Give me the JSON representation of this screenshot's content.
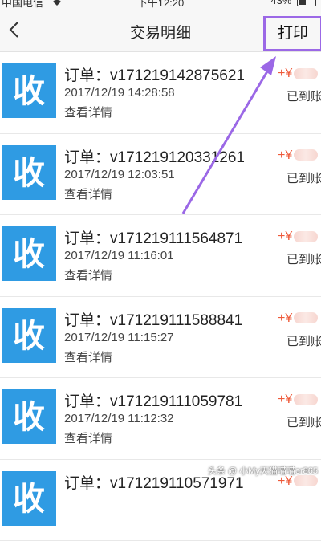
{
  "statusbar": {
    "carrier": "中国电信",
    "time": "下午12:20",
    "battery": "43%",
    "battery_level": 0.43
  },
  "nav": {
    "title": "交易明细",
    "print_label": "打印"
  },
  "colors": {
    "accent": "#2f9be3",
    "amount": "#ee5a3a",
    "highlight": "#9b68e6"
  },
  "transactions": [
    {
      "order": "订单：v171219142875621",
      "date": "2017/12/19 14:28:58",
      "detail": "查看详情",
      "amount": "+¥",
      "status": "已到账"
    },
    {
      "order": "订单：v171219120331261",
      "date": "2017/12/19 12:03:51",
      "detail": "查看详情",
      "amount": "+¥",
      "status": "已到账"
    },
    {
      "order": "订单：v171219111564871",
      "date": "2017/12/19 11:16:01",
      "detail": "查看详情",
      "amount": "+¥",
      "status": "已到账"
    },
    {
      "order": "订单：v171219111588841",
      "date": "2017/12/19 11:15:27",
      "detail": "查看详情",
      "amount": "+¥",
      "status": "已到账"
    },
    {
      "order": "订单：v171219111059781",
      "date": "2017/12/19 11:12:32",
      "detail": "查看详情",
      "amount": "+¥",
      "status": "已到账"
    },
    {
      "order": "订单：v171219110571971",
      "date": "",
      "detail": "",
      "amount": "+¥",
      "status": ""
    }
  ],
  "watermark": "头条 @ 小My天猫喵喵er865"
}
